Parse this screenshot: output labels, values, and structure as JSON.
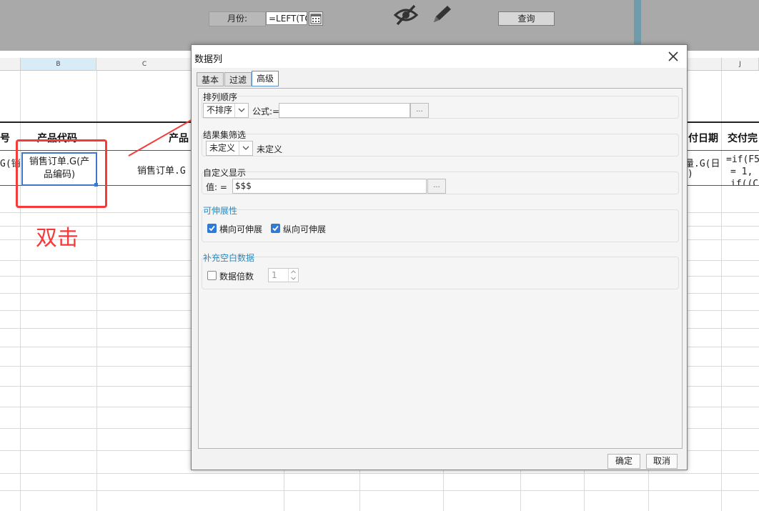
{
  "toolbar": {
    "month_label": "月份:",
    "month_value": "=LEFT(TO",
    "query_label": "查询",
    "eye_icon": "eye-slash-icon",
    "edit_icon": "pencil-icon"
  },
  "sheet": {
    "col_headers": [
      "B",
      "C",
      "J"
    ],
    "header_left_fragment": "号",
    "header_product_code": "产品代码",
    "header_product_fragment": "产品",
    "header_pay_date_fragment": "付日期",
    "header_deliver_fragment": "交付完",
    "row_left_fragment": "G(销",
    "selected_cell_line1": "销售订单.G(产",
    "selected_cell_line2": "品编码)",
    "cell_c_fragment": "销售订单.G",
    "cell_i_line1": "量.G(日",
    "cell_i_line2": ")",
    "cell_j_line1": "=if(F5",
    "cell_j_line2": "= 1,",
    "cell_j_line3": "if((C"
  },
  "annotation": {
    "double_click_label": "双击",
    "color": "#f53a3a"
  },
  "dialog": {
    "title": "数据列",
    "tabs": [
      {
        "label": "基本",
        "active": false
      },
      {
        "label": "过滤",
        "active": false
      },
      {
        "label": "高级",
        "active": true
      }
    ],
    "sort": {
      "title": "排列顺序",
      "select_value": "不排序",
      "formula_label": "公式:=",
      "formula_value": "",
      "browse_label": "..."
    },
    "filter": {
      "title": "结果集筛选",
      "select_value": "未定义",
      "value_text": "未定义"
    },
    "display": {
      "title": "自定义显示",
      "value_label": "值: =",
      "value": "$$$",
      "browse_label": "..."
    },
    "expand": {
      "title": "可伸展性",
      "horizontal_label": "横向可伸展",
      "horizontal_checked": true,
      "vertical_label": "纵向可伸展",
      "vertical_checked": true
    },
    "fill": {
      "title": "补充空白数据",
      "multiple_label": "数据倍数",
      "multiple_checked": false,
      "multiple_value": "1"
    },
    "ok_label": "确定",
    "cancel_label": "取消"
  },
  "colors": {
    "toolbar_bg": "#a9a9a9",
    "selection_blue": "#3d79c8",
    "checkbox_blue": "#2f7ad6",
    "group_title_blue": "#2a8bc0"
  }
}
